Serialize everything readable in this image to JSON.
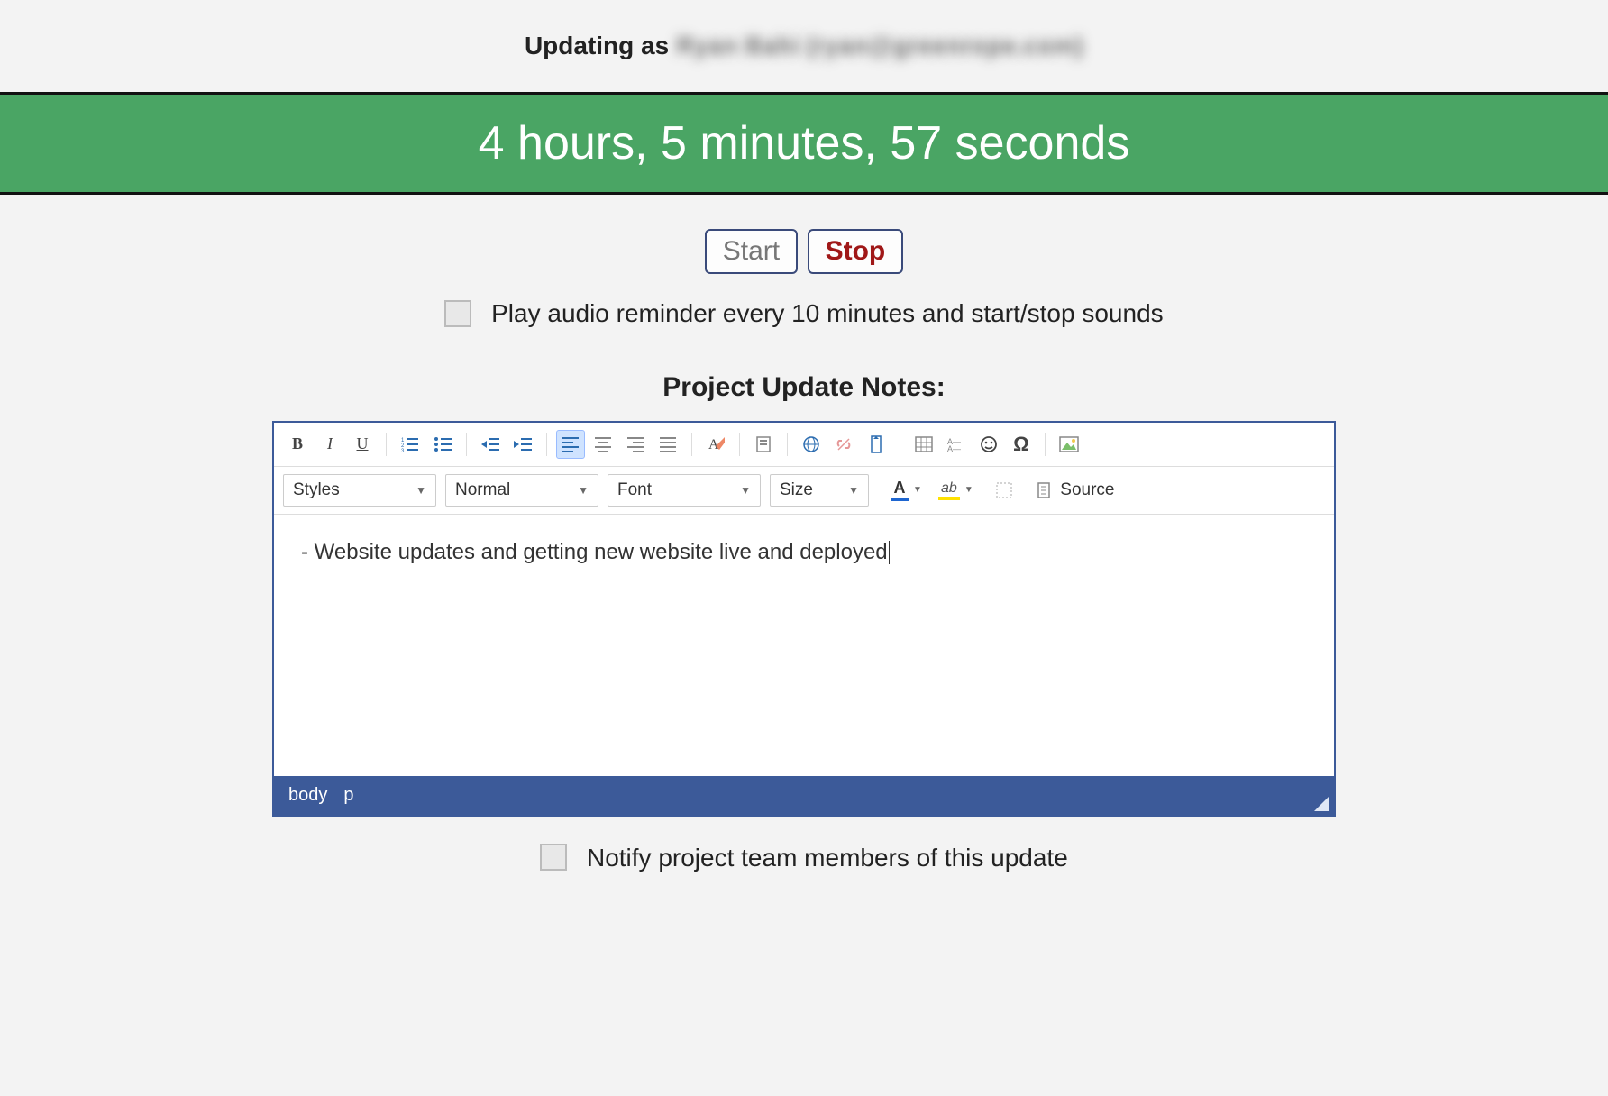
{
  "header": {
    "prefix": "Updating as ",
    "user_blurred": "Ryan Bahi (ryan@greenrope.com)"
  },
  "timer": {
    "display": "4 hours, 5 minutes, 57 seconds"
  },
  "controls": {
    "start_label": "Start",
    "stop_label": "Stop"
  },
  "audio_reminder": {
    "checked": false,
    "label": "Play audio reminder every 10 minutes and start/stop sounds"
  },
  "notes": {
    "section_label": "Project Update Notes:",
    "content": "- Website updates and getting new website live and deployed"
  },
  "editor_toolbar": {
    "styles_label": "Styles",
    "format_label": "Normal",
    "font_label": "Font",
    "size_label": "Size",
    "source_label": "Source"
  },
  "editor_footer": {
    "path_body": "body",
    "path_p": "p"
  },
  "notify": {
    "checked": false,
    "label": "Notify project team members of this update"
  }
}
